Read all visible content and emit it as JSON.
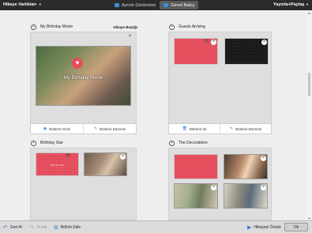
{
  "topbar": {
    "left_menu": "Hikaye Varlıkları",
    "tabs": [
      {
        "label": "Ayrıntı Görünümü",
        "active": false
      },
      {
        "label": "Genel Bakış",
        "active": true
      }
    ],
    "right_menu": "Yayınla+Paylaş"
  },
  "chapters": [
    {
      "title": "My Birthday Movie",
      "header_right": "Hikaye Başlığı",
      "photo_title": "My Birthday Movie",
      "buttons": [
        "Bölümü Gizle",
        "Bölümü Düzenle"
      ]
    },
    {
      "title": "Guests Arriving",
      "buttons": [
        "Bölümü Sil",
        "Bölümü Düzenle"
      ]
    },
    {
      "title": "Birthday Star",
      "thumb_label": "Birthday Star"
    },
    {
      "title": "The Decorations"
    }
  ],
  "bottombar": {
    "undo": "Geri Al",
    "redo": "Yinele",
    "add_chapter": "Bölüm Ekle",
    "preview": "Hikayeyi Önizle",
    "ok": "Ok"
  },
  "colors": {
    "accent": "#3b7dd8",
    "title_card_red": "#e44d5c"
  }
}
